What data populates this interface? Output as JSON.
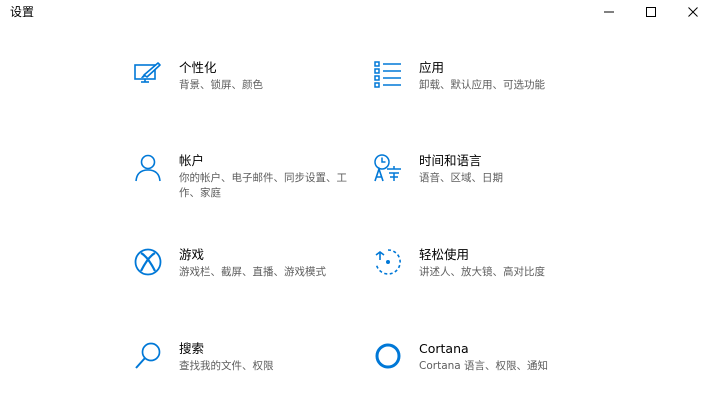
{
  "window": {
    "title": "设置"
  },
  "tiles": [
    {
      "name": "个性化",
      "desc": "背景、锁屏、颜色",
      "icon": "personalization-icon"
    },
    {
      "name": "应用",
      "desc": "卸载、默认应用、可选功能",
      "icon": "apps-icon"
    },
    {
      "name": "帐户",
      "desc": "你的帐户、电子邮件、同步设置、工作、家庭",
      "icon": "account-icon"
    },
    {
      "name": "时间和语言",
      "desc": "语音、区域、日期",
      "icon": "time-language-icon"
    },
    {
      "name": "游戏",
      "desc": "游戏栏、截屏、直播、游戏模式",
      "icon": "xbox-icon"
    },
    {
      "name": "轻松使用",
      "desc": "讲述人、放大镜、高对比度",
      "icon": "ease-of-access-icon"
    },
    {
      "name": "搜索",
      "desc": "查找我的文件、权限",
      "icon": "search-icon"
    },
    {
      "name": "Cortana",
      "desc": "Cortana 语言、权限、通知",
      "icon": "cortana-icon"
    }
  ],
  "colors": {
    "accent": "#0078d7",
    "text": "#000000",
    "secondary_text": "#5d5d5d"
  }
}
